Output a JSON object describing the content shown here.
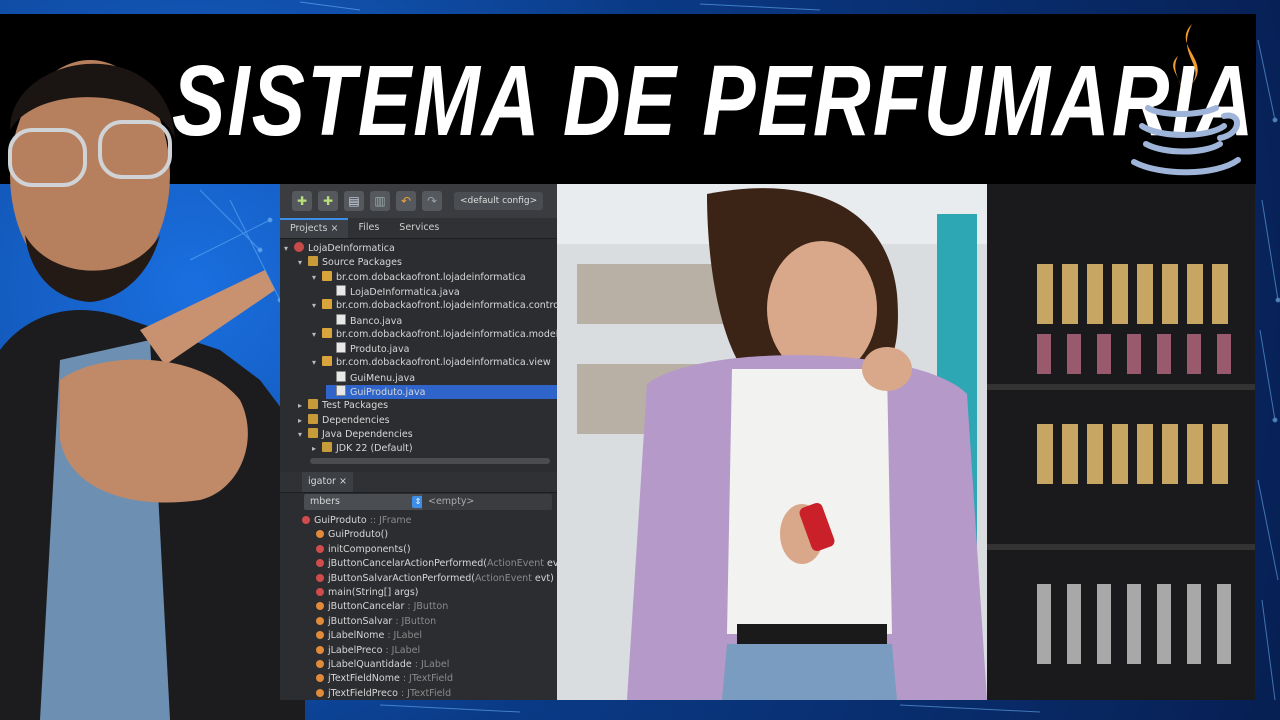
{
  "banner": {
    "title": "SISTEMA DE PERFUMARIA"
  },
  "ide": {
    "toolbar": {
      "config": "<default config>"
    },
    "tabs": [
      {
        "label": "Projects ×",
        "active": true
      },
      {
        "label": "Files",
        "active": false
      },
      {
        "label": "Services",
        "active": false
      }
    ],
    "tree": [
      {
        "label": "LojaDeInformatica",
        "icon": "project-icon",
        "indent": 0,
        "arrow": "▾"
      },
      {
        "label": "Source Packages",
        "icon": "folder-icon",
        "indent": 1,
        "arrow": "▾"
      },
      {
        "label": "br.com.dobackaofront.lojadeinformatica",
        "icon": "package-icon",
        "indent": 2,
        "arrow": "▾"
      },
      {
        "label": "LojaDeInformatica.java",
        "icon": "java-file-icon",
        "indent": 3,
        "arrow": ""
      },
      {
        "label": "br.com.dobackaofront.lojadeinformatica.controller",
        "icon": "package-icon",
        "indent": 2,
        "arrow": "▾"
      },
      {
        "label": "Banco.java",
        "icon": "java-file-icon",
        "indent": 3,
        "arrow": ""
      },
      {
        "label": "br.com.dobackaofront.lojadeinformatica.model",
        "icon": "package-icon",
        "indent": 2,
        "arrow": "▾"
      },
      {
        "label": "Produto.java",
        "icon": "java-file-icon",
        "indent": 3,
        "arrow": ""
      },
      {
        "label": "br.com.dobackaofront.lojadeinformatica.view",
        "icon": "package-icon",
        "indent": 2,
        "arrow": "▾"
      },
      {
        "label": "GuiMenu.java",
        "icon": "java-file-icon",
        "indent": 3,
        "arrow": ""
      },
      {
        "label": "GuiProduto.java",
        "icon": "java-file-icon",
        "indent": 3,
        "arrow": "",
        "selected": true
      },
      {
        "label": "Test Packages",
        "icon": "folder-icon",
        "indent": 1,
        "arrow": "▸"
      },
      {
        "label": "Dependencies",
        "icon": "folder-icon",
        "indent": 1,
        "arrow": "▸"
      },
      {
        "label": "Java Dependencies",
        "icon": "folder-icon",
        "indent": 1,
        "arrow": "▾"
      },
      {
        "label": "JDK 22 (Default)",
        "icon": "folder-icon",
        "indent": 2,
        "arrow": "▸"
      }
    ],
    "navigator": {
      "tab": "igator ×",
      "members_combo": "mbers",
      "filter_combo": "<empty>",
      "items": [
        {
          "name": "GuiProduto",
          "type": " :: JFrame",
          "icon": "class-icon",
          "indent": 0
        },
        {
          "name": "GuiProduto()",
          "type": "",
          "icon": "constructor-icon",
          "indent": 1
        },
        {
          "name": "initComponents()",
          "type": "",
          "icon": "private-method-icon",
          "indent": 1
        },
        {
          "name": "jButtonCancelarActionPerformed(",
          "type": "ActionEvent",
          "tail": " evt)",
          "icon": "private-method-icon",
          "indent": 1
        },
        {
          "name": "jButtonSalvarActionPerformed(",
          "type": "ActionEvent",
          "tail": " evt)",
          "icon": "private-method-icon",
          "indent": 1
        },
        {
          "name": "main(String[] args)",
          "type": "",
          "icon": "static-method-icon",
          "indent": 1
        },
        {
          "name": "jButtonCancelar",
          "type": " : JButton",
          "icon": "field-icon",
          "indent": 1
        },
        {
          "name": "jButtonSalvar",
          "type": " : JButton",
          "icon": "field-icon",
          "indent": 1
        },
        {
          "name": "jLabelNome",
          "type": " : JLabel",
          "icon": "field-icon",
          "indent": 1
        },
        {
          "name": "jLabelPreco",
          "type": " : JLabel",
          "icon": "field-icon",
          "indent": 1
        },
        {
          "name": "jLabelQuantidade",
          "type": " : JLabel",
          "icon": "field-icon",
          "indent": 1
        },
        {
          "name": "jTextFieldNome",
          "type": " : JTextField",
          "icon": "field-icon",
          "indent": 1
        },
        {
          "name": "jTextFieldPreco",
          "type": " : JTextField",
          "icon": "field-icon",
          "indent": 1
        }
      ]
    }
  }
}
